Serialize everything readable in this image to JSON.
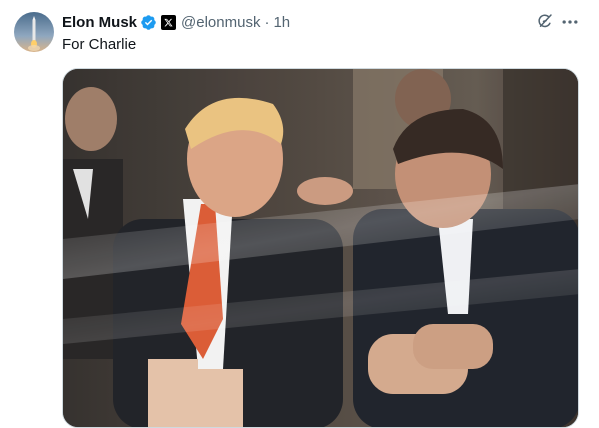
{
  "post": {
    "author_name": "Elon Musk",
    "author_handle": "@elonmusk",
    "separator": "·",
    "time_ago": "1h",
    "text": "For Charlie",
    "verified_badge_color": "#1d9bf0",
    "affiliate_badge": "x-logo-icon"
  },
  "actions": {
    "grok_icon": "grok-icon",
    "more_icon": "more-icon"
  },
  "media": {
    "type": "photo"
  }
}
